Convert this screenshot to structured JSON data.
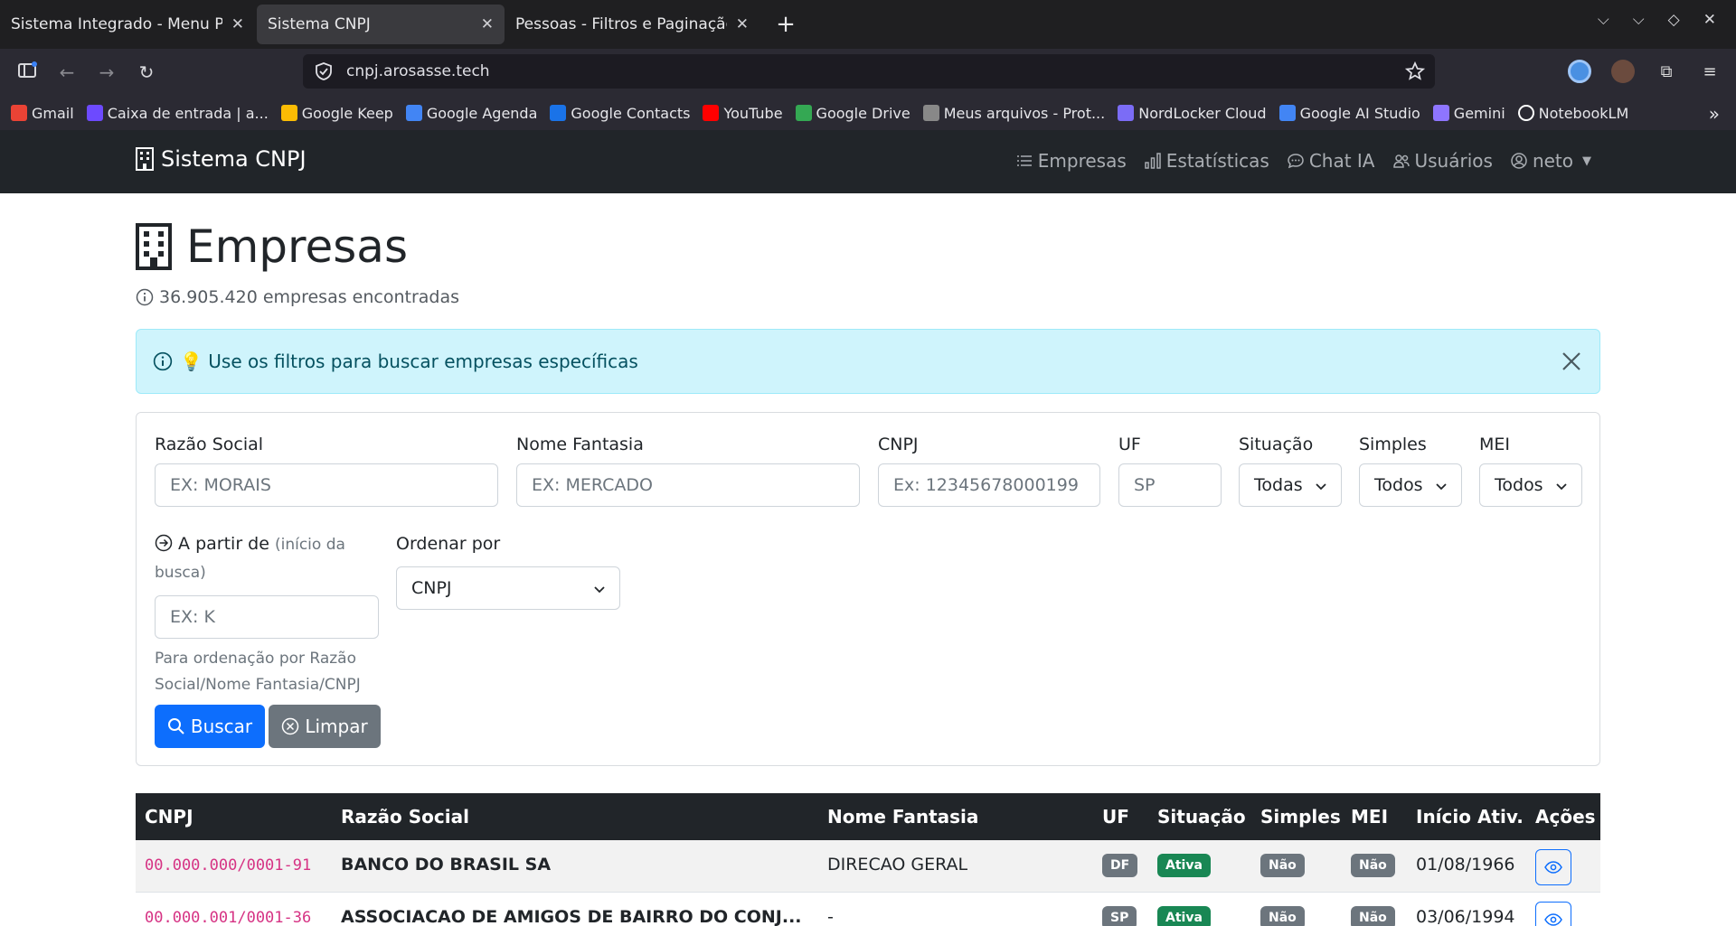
{
  "browser": {
    "tabs": [
      {
        "title": "Sistema Integrado - Menu Prir",
        "active": false
      },
      {
        "title": "Sistema CNPJ",
        "active": true
      },
      {
        "title": "Pessoas - Filtros e Paginação",
        "active": false
      }
    ],
    "url": "cnpj.arosasse.tech",
    "bookmarks": [
      {
        "label": "Gmail",
        "icon": "gmail-icon",
        "color": "#ea4335"
      },
      {
        "label": "Caixa de entrada | a...",
        "icon": "mail-icon",
        "color": "#6d4aff"
      },
      {
        "label": "Google Keep",
        "icon": "keep-icon",
        "color": "#fbbc04"
      },
      {
        "label": "Google Agenda",
        "icon": "google-icon",
        "color": "#4285f4"
      },
      {
        "label": "Google Contacts",
        "icon": "contacts-icon",
        "color": "#1a73e8"
      },
      {
        "label": "YouTube",
        "icon": "youtube-icon",
        "color": "#ff0000"
      },
      {
        "label": "Google Drive",
        "icon": "drive-icon",
        "color": "#34a853"
      },
      {
        "label": "Meus arquivos - Prot...",
        "icon": "globe-icon",
        "color": "#888888"
      },
      {
        "label": "NordLocker Cloud",
        "icon": "nordlocker-icon",
        "color": "#7b6cf6"
      },
      {
        "label": "Google AI Studio",
        "icon": "ai-studio-icon",
        "color": "#4285f4"
      },
      {
        "label": "Gemini",
        "icon": "gemini-icon",
        "color": "#8e75ff"
      },
      {
        "label": "NotebookLM",
        "icon": "notebooklm-icon",
        "color": "#ffffff"
      }
    ]
  },
  "app": {
    "brand": "Sistema CNPJ",
    "nav": {
      "empresas": "Empresas",
      "estatisticas": "Estatísticas",
      "chat": "Chat IA",
      "usuarios": "Usuários",
      "user": "neto"
    }
  },
  "page": {
    "title": "Empresas",
    "count": "36.905.420 empresas encontradas",
    "alert": "💡 Use os filtros para buscar empresas específicas"
  },
  "filters": {
    "razao_label": "Razão Social",
    "razao_placeholder": "EX: MORAIS",
    "fantasia_label": "Nome Fantasia",
    "fantasia_placeholder": "EX: MERCADO",
    "cnpj_label": "CNPJ",
    "cnpj_placeholder": "Ex: 12345678000199",
    "uf_label": "UF",
    "uf_placeholder": "SP",
    "situacao_label": "Situação",
    "situacao_value": "Todas",
    "simples_label": "Simples",
    "simples_value": "Todos",
    "mei_label": "MEI",
    "mei_value": "Todos",
    "partir_label": "A partir de",
    "partir_sub": "(início da busca)",
    "partir_placeholder": "EX: K",
    "partir_help": "Para ordenação por Razão Social/Nome Fantasia/CNPJ",
    "ordenar_label": "Ordenar por",
    "ordenar_value": "CNPJ",
    "buscar": "Buscar",
    "limpar": "Limpar"
  },
  "table": {
    "headers": [
      "CNPJ",
      "Razão Social",
      "Nome Fantasia",
      "UF",
      "Situação",
      "Simples",
      "MEI",
      "Início Ativ.",
      "Ações"
    ],
    "rows": [
      {
        "cnpj": "00.000.000/0001-91",
        "razao": "BANCO DO BRASIL SA",
        "fantasia": "DIRECAO GERAL",
        "uf": "DF",
        "situacao": "Ativa",
        "simples": "Não",
        "mei": "Não",
        "inicio": "01/08/1966"
      },
      {
        "cnpj": "00.000.001/0001-36",
        "razao": "ASSOCIACAO DE AMIGOS DE BAIRRO DO CONJ...",
        "fantasia": "-",
        "uf": "SP",
        "situacao": "Ativa",
        "simples": "Não",
        "mei": "Não",
        "inicio": "03/06/1994"
      }
    ]
  }
}
